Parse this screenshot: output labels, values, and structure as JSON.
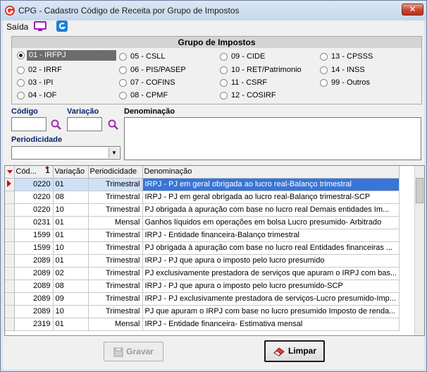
{
  "window": {
    "title": "CPG - Cadastro Código de Receita por Grupo de Impostos",
    "close_label": "✕"
  },
  "menu": {
    "saida_label": "Saída"
  },
  "grupo": {
    "header": "Grupo de Impostos",
    "options": [
      {
        "label": "01 - IRFPJ",
        "checked": true
      },
      {
        "label": "02 - IRRF"
      },
      {
        "label": "03 - IPI"
      },
      {
        "label": "04 - IOF"
      },
      {
        "label": "05 - CSLL"
      },
      {
        "label": "06 - PIS/PASEP"
      },
      {
        "label": "07 - COFINS"
      },
      {
        "label": "08 - CPMF"
      },
      {
        "label": "09 - CIDE"
      },
      {
        "label": "10 - RET/Patrimonio"
      },
      {
        "label": "11 - CSRF"
      },
      {
        "label": "12 - COSIRF"
      },
      {
        "label": "13 - CPSSS"
      },
      {
        "label": "14 - INSS"
      },
      {
        "label": "99 - Outros"
      }
    ]
  },
  "filters": {
    "codigo_label": "Código",
    "variacao_label": "Variação",
    "denominacao_label": "Denominação",
    "periodicidade_label": "Periodicidade",
    "codigo_value": "",
    "variacao_value": "",
    "denominacao_value": "",
    "periodicidade_value": ""
  },
  "grid": {
    "columns": [
      "Cód...",
      "Variação",
      "Periodicidade",
      "Denominação"
    ],
    "sort_marker": "1",
    "rows": [
      {
        "cod": "0220",
        "var": "01",
        "per": "Trimestral",
        "den": "IRPJ - PJ em geral obrigada ao lucro real-Balanço trimestral",
        "selected": true
      },
      {
        "cod": "0220",
        "var": "08",
        "per": "Trimestral",
        "den": "IRPJ - PJ em geral obrigada ao lucro real-Balanço trimestral-SCP"
      },
      {
        "cod": "0220",
        "var": "10",
        "per": "Trimestral",
        "den": "PJ obrigada à apuração com base no lucro real  Demais entidades  Im..."
      },
      {
        "cod": "0231",
        "var": "01",
        "per": "Mensal",
        "den": "Ganhos líquidos em operações em bolsa  Lucro presumido- Arbitrado"
      },
      {
        "cod": "1599",
        "var": "01",
        "per": "Trimestral",
        "den": "IRPJ - Entidade financeira-Balanço trimestral"
      },
      {
        "cod": "1599",
        "var": "10",
        "per": "Trimestral",
        "den": "PJ obrigada à apuração com base no lucro real  Entidades financeiras ..."
      },
      {
        "cod": "2089",
        "var": "01",
        "per": "Trimestral",
        "den": "IRPJ - PJ que apura o imposto pelo lucro presumido"
      },
      {
        "cod": "2089",
        "var": "02",
        "per": "Trimestral",
        "den": "PJ exclusivamente prestadora de serviços que apuram o IRPJ com bas..."
      },
      {
        "cod": "2089",
        "var": "08",
        "per": "Trimestral",
        "den": "IRPJ - PJ que apura o imposto pelo lucro presumido-SCP"
      },
      {
        "cod": "2089",
        "var": "09",
        "per": "Trimestral",
        "den": "IRPJ - PJ exclusivamente prestadora de serviços-Lucro presumido-Imp..."
      },
      {
        "cod": "2089",
        "var": "10",
        "per": "Trimestral",
        "den": "PJ que apuram o IRPJ com base no lucro presumido  Imposto de renda..."
      },
      {
        "cod": "2319",
        "var": "01",
        "per": "Mensal",
        "den": "IRPJ - Entidade financeira- Estimativa mensal"
      }
    ]
  },
  "buttons": {
    "gravar": "Gravar",
    "limpar": "Limpar"
  },
  "colors": {
    "selection": "#3875d7",
    "accent_red": "#dd0000",
    "label_blue": "#0a246a"
  }
}
